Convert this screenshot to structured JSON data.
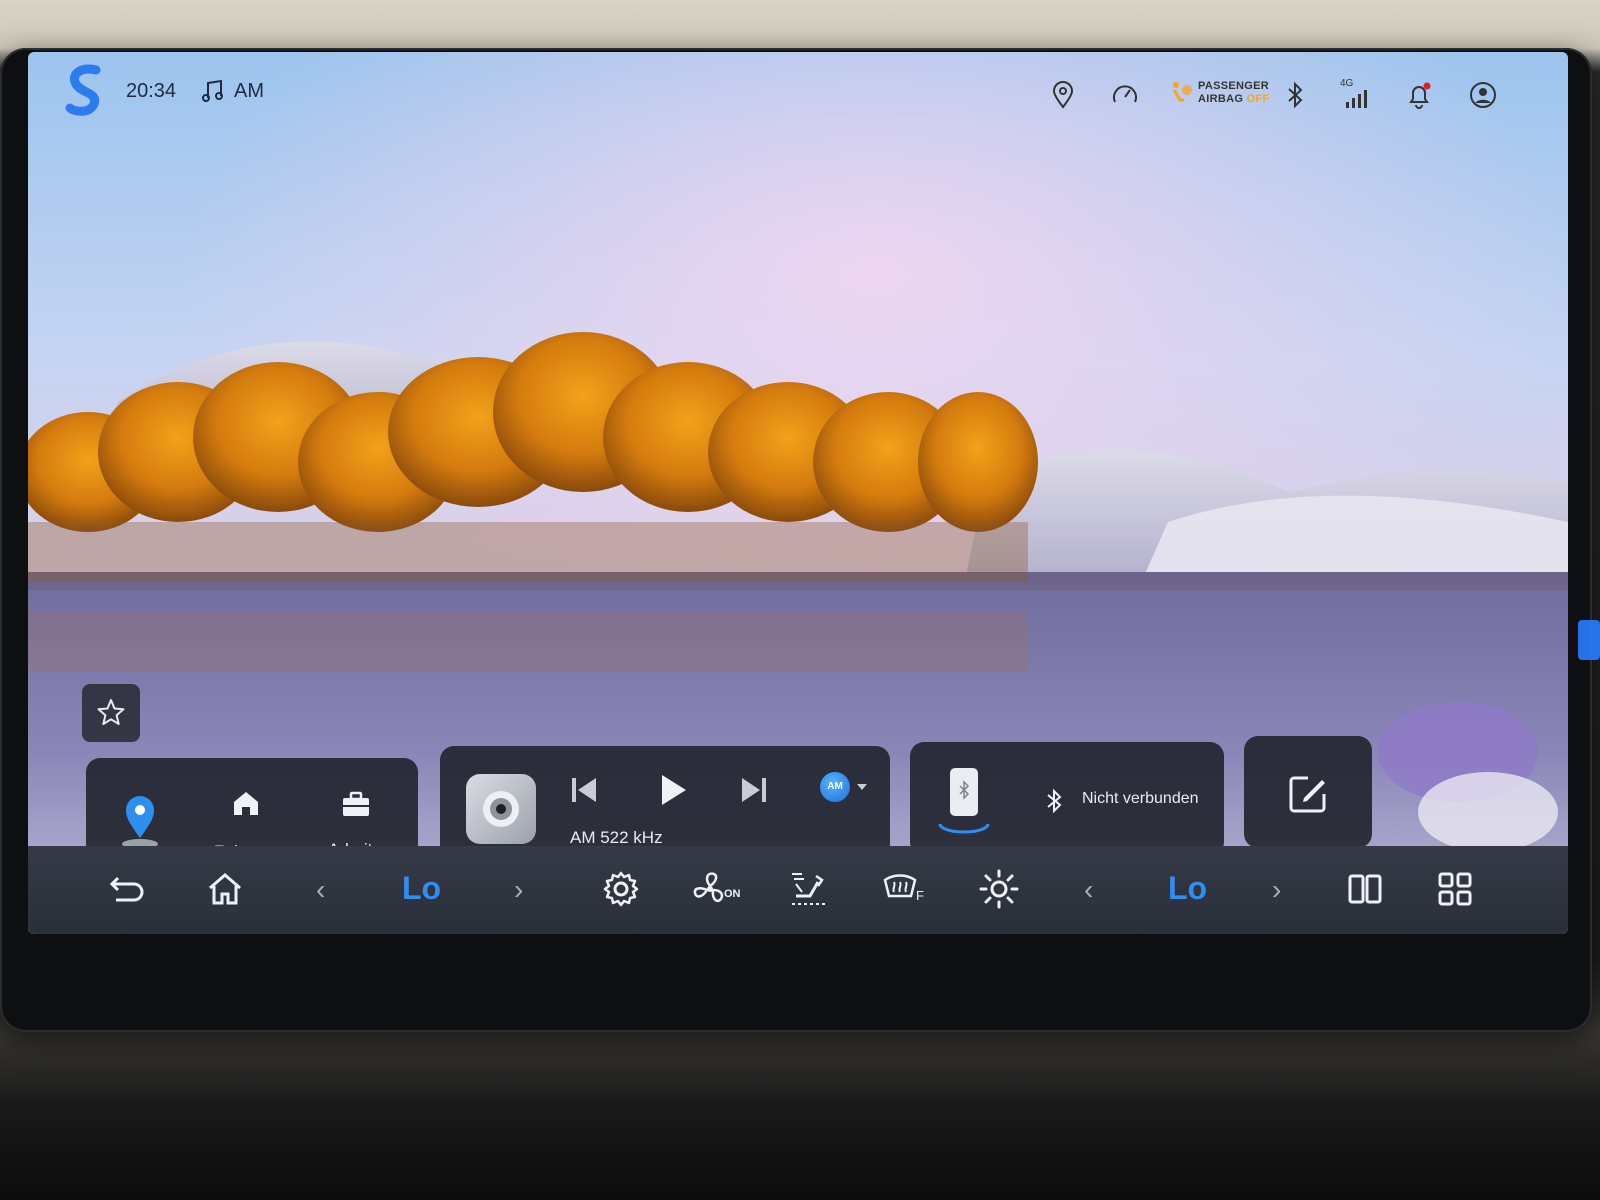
{
  "status_bar": {
    "time": "20:34",
    "audio_source": "AM",
    "airbag_line1": "PASSENGER",
    "airbag_line2": "AIRBAG",
    "airbag_state": "OFF",
    "network": "4G",
    "icons": [
      "app-logo-icon",
      "music-note-icon",
      "location-pin-icon",
      "speed-gauge-icon",
      "airbag-icon",
      "bluetooth-icon",
      "signal-icon",
      "notification-bell-icon",
      "user-profile-icon"
    ]
  },
  "favorites_button": {
    "icon": "favorite-star-icon"
  },
  "navigation_card": {
    "home_label": "Zuhause",
    "work_label": "Arbeit"
  },
  "media_card": {
    "station": "AM 522 kHz",
    "source_badge": "AM",
    "icons": [
      "radio-app-icon",
      "previous-track-icon",
      "play-icon",
      "next-track-icon",
      "source-select-icon"
    ]
  },
  "phone_card": {
    "bluetooth_status": "Nicht verbunden"
  },
  "dock": {
    "driver_temp": "Lo",
    "passenger_temp": "Lo",
    "fan_status": "ON",
    "defrost_label": "F",
    "icons": [
      "back-icon",
      "home-icon",
      "settings-gear-icon",
      "fan-icon",
      "seat-airflow-icon",
      "windshield-defrost-icon",
      "brightness-icon",
      "split-screen-icon",
      "app-grid-icon"
    ]
  },
  "colors": {
    "accent_blue": "#2f8ff0",
    "airbag_off": "#f5a623",
    "card_bg": "#23273a",
    "dock_bg": "#2f3440"
  }
}
